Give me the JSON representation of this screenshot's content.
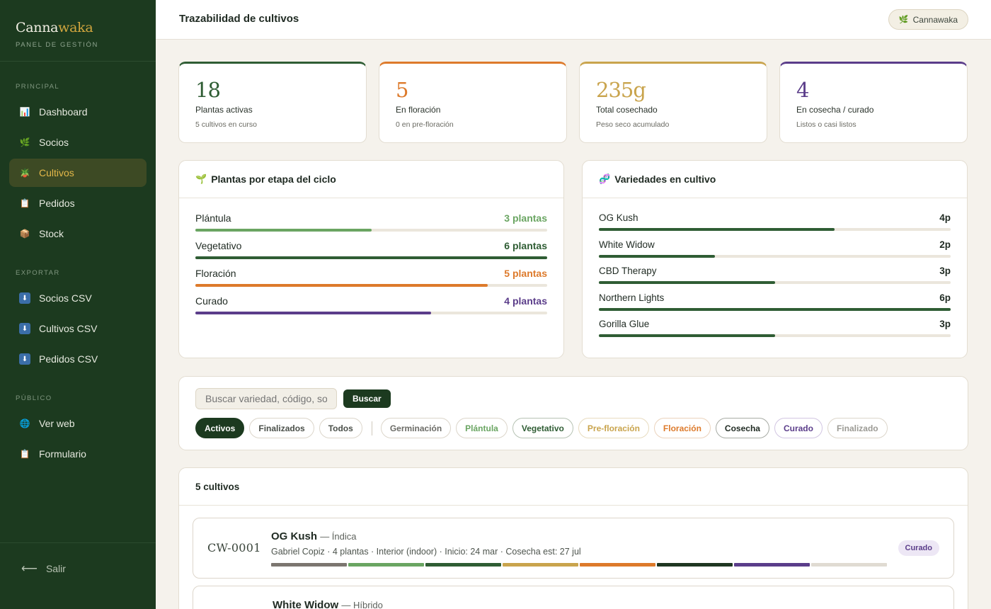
{
  "brand": {
    "name_main": "Canna",
    "name_accent": "waka",
    "subtitle": "PANEL DE GESTIÓN"
  },
  "sidebar": {
    "sections": [
      {
        "title": "PRINCIPAL",
        "items": [
          {
            "label": "Dashboard",
            "icon": "chart-icon"
          },
          {
            "label": "Socios",
            "icon": "leaf-icon"
          },
          {
            "label": "Cultivos",
            "icon": "potted-plant-icon",
            "active": true
          },
          {
            "label": "Pedidos",
            "icon": "clipboard-icon"
          },
          {
            "label": "Stock",
            "icon": "box-icon"
          }
        ]
      },
      {
        "title": "EXPORTAR",
        "items": [
          {
            "label": "Socios CSV",
            "icon": "download-icon"
          },
          {
            "label": "Cultivos CSV",
            "icon": "download-icon"
          },
          {
            "label": "Pedidos CSV",
            "icon": "download-icon"
          }
        ]
      },
      {
        "title": "PÚBLICO",
        "items": [
          {
            "label": "Ver web",
            "icon": "globe-icon"
          },
          {
            "label": "Formulario",
            "icon": "clipboard-icon"
          }
        ]
      }
    ],
    "logout_label": "Salir"
  },
  "header": {
    "title": "Trazabilidad de cultivos",
    "user_chip": "Cannawaka"
  },
  "stats": [
    {
      "value": "18",
      "label": "Plantas activas",
      "sub": "5 cultivos en curso",
      "color": "#2f5d34"
    },
    {
      "value": "5",
      "label": "En floración",
      "sub": "0 en pre-floración",
      "color": "#dd7a2b"
    },
    {
      "value": "235g",
      "label": "Total cosechado",
      "sub": "Peso seco acumulado",
      "color": "#c9a44d"
    },
    {
      "value": "4",
      "label": "En cosecha / curado",
      "sub": "Listos o casi listos",
      "color": "#5b3d8a"
    }
  ],
  "stages_panel": {
    "title": "Plantas por etapa del ciclo",
    "rows": [
      {
        "label": "Plántula",
        "count": "3 plantas",
        "fraction": 0.5,
        "color": "#6aa562"
      },
      {
        "label": "Vegetativo",
        "count": "6 plantas",
        "fraction": 1.0,
        "color": "#2f5d34"
      },
      {
        "label": "Floración",
        "count": "5 plantas",
        "fraction": 0.83,
        "color": "#dd7a2b"
      },
      {
        "label": "Curado",
        "count": "4 plantas",
        "fraction": 0.67,
        "color": "#5b3d8a"
      }
    ]
  },
  "varieties_panel": {
    "title": "Variedades en cultivo",
    "rows": [
      {
        "label": "OG Kush",
        "count": "4p",
        "fraction": 0.67
      },
      {
        "label": "White Widow",
        "count": "2p",
        "fraction": 0.33
      },
      {
        "label": "CBD Therapy",
        "count": "3p",
        "fraction": 0.5
      },
      {
        "label": "Northern Lights",
        "count": "6p",
        "fraction": 1.0
      },
      {
        "label": "Gorilla Glue",
        "count": "3p",
        "fraction": 0.5
      }
    ],
    "bar_color": "#2f5d34"
  },
  "filters": {
    "search_placeholder": "Buscar variedad, código, so",
    "search_button": "Buscar",
    "scope_pills": [
      {
        "label": "Activos",
        "active": true
      },
      {
        "label": "Finalizados"
      },
      {
        "label": "Todos"
      }
    ],
    "stage_pills": [
      {
        "label": "Germinación",
        "color": "#6b6b66",
        "border": "#dcd6cb"
      },
      {
        "label": "Plántula",
        "color": "#6aa562",
        "border": "#dcd6cb"
      },
      {
        "label": "Vegetativo",
        "color": "#2f5d34",
        "border": "#b7c3b4"
      },
      {
        "label": "Pre-floración",
        "color": "#c9a44d",
        "border": "#e8dcc0"
      },
      {
        "label": "Floración",
        "color": "#dd7a2b",
        "border": "#ebd3bd"
      },
      {
        "label": "Cosecha",
        "color": "#1f2a22",
        "border": "#a8aca5"
      },
      {
        "label": "Curado",
        "color": "#5b3d8a",
        "border": "#d2c6e2"
      },
      {
        "label": "Finalizado",
        "color": "#9b9a94",
        "border": "#dcd6cb"
      }
    ]
  },
  "crops_list": {
    "title": "5 cultivos",
    "items": [
      {
        "code": "CW-0001",
        "variety": "OG Kush",
        "type": "— Índica",
        "meta": "Gabriel Copiz · 4 plantas · Interior (indoor) · Inicio: 24 mar · Cosecha est: 27 jul",
        "status": "Curado",
        "stage_colors": [
          "#7c7670",
          "#6aa562",
          "#2f5d34",
          "#c9a44d",
          "#dd7a2b",
          "#1f3622",
          "#5b3d8a",
          "#e0dbd2"
        ]
      },
      {
        "code": "",
        "variety": "White Widow",
        "type": "— Híbrido"
      }
    ]
  }
}
